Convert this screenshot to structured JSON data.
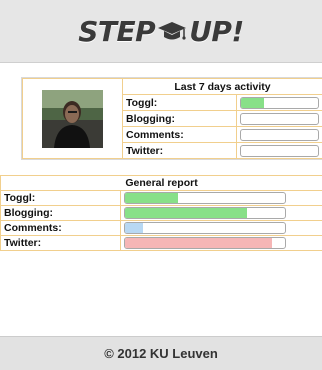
{
  "header": {
    "logo_left": "STEP",
    "logo_right": "UP!"
  },
  "activity": {
    "title": "Last 7 days activity",
    "rows": [
      {
        "label": "Toggl:",
        "value": 0.3,
        "color": "#88e088"
      },
      {
        "label": "Blogging:",
        "value": 0,
        "color": "#88e088"
      },
      {
        "label": "Comments:",
        "value": 0,
        "color": "#88e088"
      },
      {
        "label": "Twitter:",
        "value": 0,
        "color": "#88e088"
      }
    ]
  },
  "report": {
    "title": "General report",
    "rows": [
      {
        "label": "Toggl:",
        "value": 0.33,
        "color": "#88e088"
      },
      {
        "label": "Blogging:",
        "value": 0.76,
        "color": "#88e088"
      },
      {
        "label": "Comments:",
        "value": 0.11,
        "color": "#b8d8f3"
      },
      {
        "label": "Twitter:",
        "value": 0.92,
        "color": "#f6b6b6"
      }
    ]
  },
  "footer": {
    "text": "© 2012 KU Leuven"
  }
}
